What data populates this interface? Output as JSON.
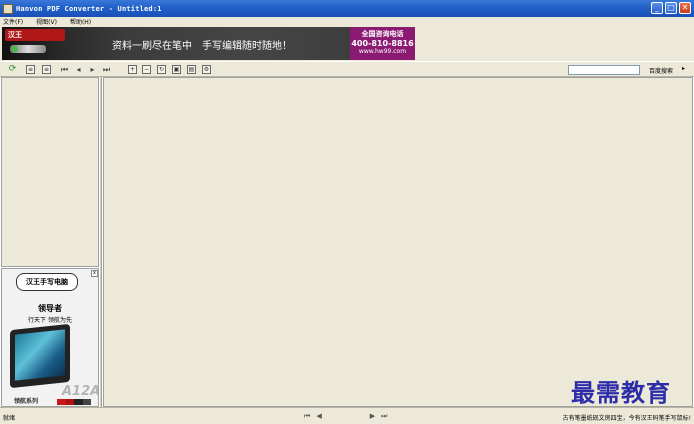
{
  "window": {
    "title": "Hanvon PDF Converter - Untitled:1"
  },
  "menu": {
    "items": [
      "文件(F)",
      "视图(V)",
      "帮助(H)"
    ]
  },
  "banner": {
    "logo_text": "汉王",
    "slogan": "资料一刷尽在笔中　手写编辑随时随地！",
    "phone_title": "全国咨询电话",
    "phone_number": "400-810-8816",
    "website": "www.hw99.com"
  },
  "toolbar": {
    "search_placeholder": "",
    "search_label": "百度搜索",
    "dropdown_arrow": "▸"
  },
  "side_ad": {
    "logo": "汉王手写电脑",
    "headline": "领导者",
    "subline": "行天下 领航为先",
    "series": "领航系列",
    "model": "A12A",
    "bar_labels": [
      "",
      "",
      "",
      ""
    ]
  },
  "status": {
    "left": "就绪",
    "nav": [
      "⏮",
      "◀",
      "▶",
      "⏭"
    ],
    "right": "古有笔墨纸砚文房四宝，今有汉王码笔手写鼠标!"
  },
  "watermark": "最需教育",
  "colors": {
    "titlebar": "#2060c8",
    "phone_box": "#8b1a73",
    "watermark": "#2d2daa"
  }
}
